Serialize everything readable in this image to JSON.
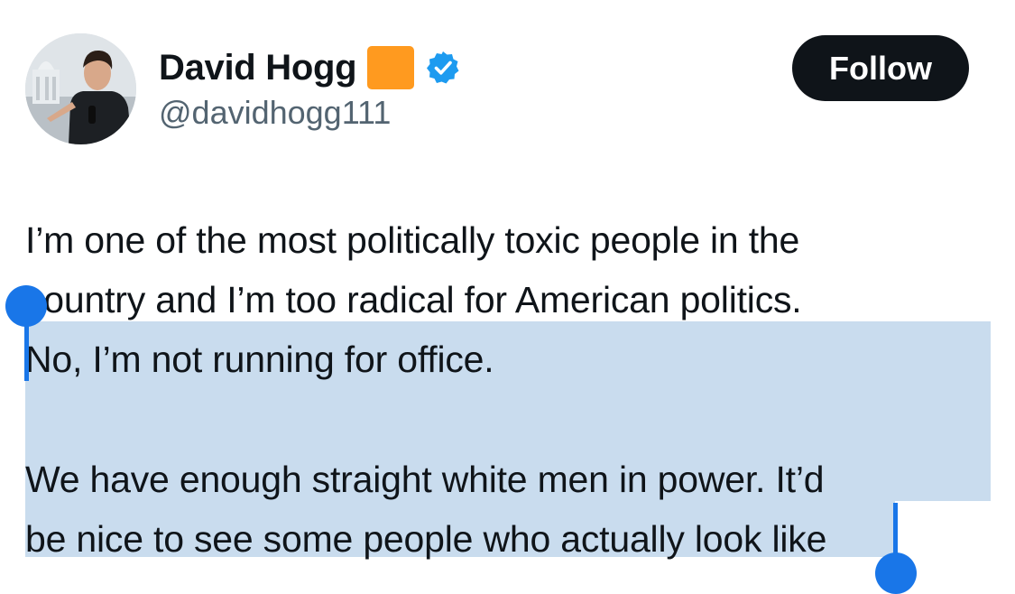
{
  "post": {
    "author": {
      "display_name": "David Hogg",
      "handle": "@davidhogg111",
      "name_emoji_color": "#ff9a1f",
      "verified_badge_color": "#1d9bf0",
      "avatar_icon": "profile-photo-icon"
    },
    "follow_button_label": "Follow",
    "text_lines": [
      "I’m one of the most politically toxic people in the",
      "country and I’m too radical for American politics.",
      "No, I’m not running for office.",
      "We have enough straight white men in power. It’d",
      "be nice to see some people who actually look like"
    ]
  },
  "selection": {
    "highlight_color": "#c9dcee",
    "handle_color": "#1976e8",
    "handle_icons": [
      "selection-start-handle-icon",
      "selection-end-handle-icon"
    ]
  }
}
